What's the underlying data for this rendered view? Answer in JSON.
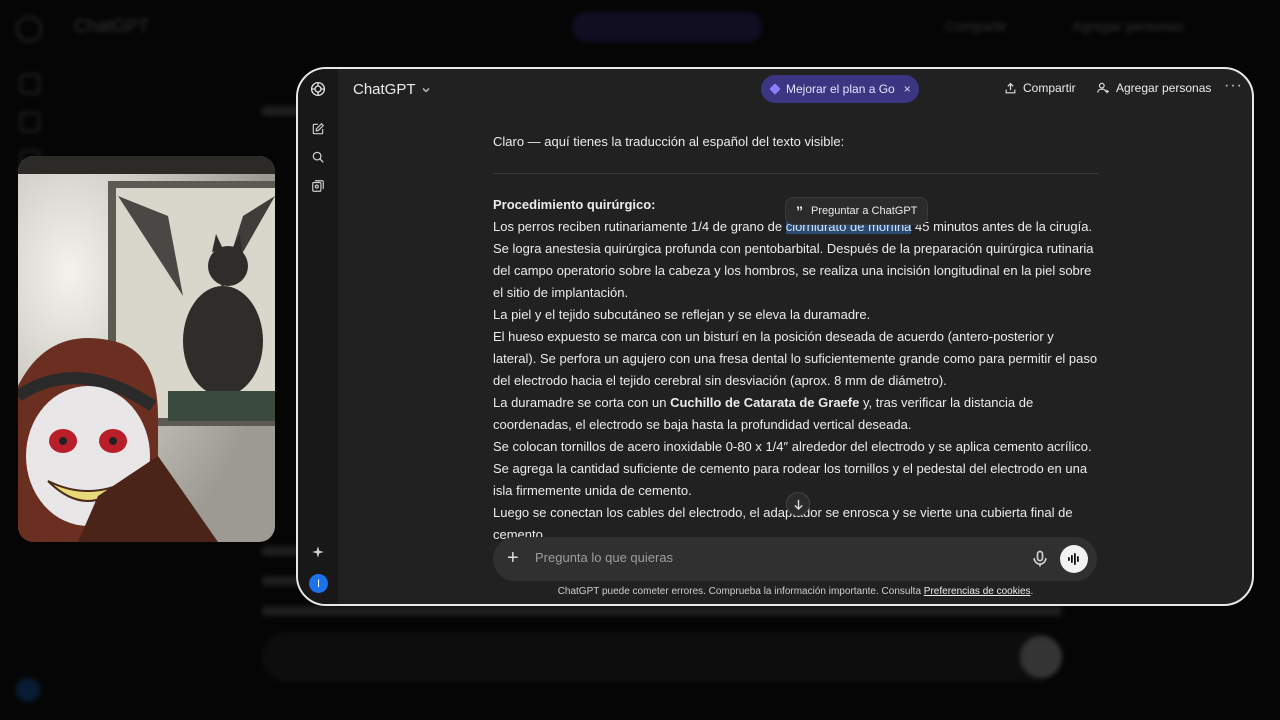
{
  "window": {
    "model_label": "ChatGPT",
    "upgrade_label": "Mejorar el plan a Go",
    "share_label": "Compartir",
    "add_people_label": "Agregar personas",
    "more_label": "···",
    "avatar_letter": "I"
  },
  "message": {
    "intro": "Claro — aquí tienes la traducción al español del texto visible:",
    "section_title": "Procedimiento quirúrgico:",
    "p1_before": "Los perros reciben rutinariamente 1/4 de grano de ",
    "p1_highlight": "clorhidrato de morfina",
    "p1_after": " 45 minutos antes de la cirugía. Se logra anestesia quirúrgica profunda con pentobarbital. Después de la preparación quirúrgica rutinaria del campo operatorio sobre la cabeza y los hombros, se realiza una incisión longitudinal en la piel sobre el sitio de implantación.",
    "p2": "La piel y el tejido subcutáneo se reflejan y se eleva la duramadre.",
    "p3": "El hueso expuesto se marca con un bisturí en la posición deseada de acuerdo (antero-posterior y lateral). Se perfora un agujero con una fresa dental lo suficientemente grande como para permitir el paso del electrodo hacia el tejido cerebral sin desviación (aprox. 8 mm de diámetro).",
    "p4_before": "La duramadre se corta con un ",
    "p4_bold": "Cuchillo de Catarata de Graefe",
    "p4_after": " y, tras verificar la distancia de coordenadas, el electrodo se baja hasta la profundidad vertical deseada.",
    "p5": "Se colocan tornillos de acero inoxidable 0-80 x 1/4″ alrededor del electrodo y se aplica cemento acrílico. Se agrega la cantidad suficiente de cemento para rodear los tornillos y el pedestal del electrodo en una isla firmemente unida de cemento.",
    "p6": "Luego se conectan los cables del electrodo, el adaptador se enrosca y se vierte una cubierta final de cemento."
  },
  "tooltip": {
    "label": "Preguntar a ChatGPT"
  },
  "composer": {
    "placeholder": "Pregunta lo que quieras"
  },
  "footer": {
    "text": "ChatGPT puede cometer errores. Comprueba la información importante. Consulta ",
    "link": "Preferencias de cookies",
    "end": "."
  },
  "background": {
    "title": "ChatGPT",
    "share_label": "Compartir",
    "people_label": "Agregar personas"
  }
}
